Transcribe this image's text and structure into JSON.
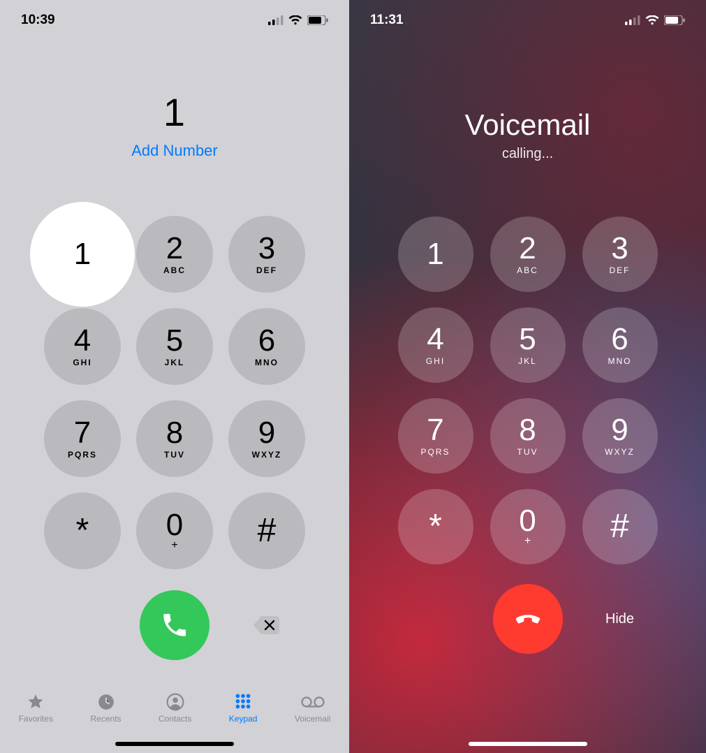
{
  "left": {
    "status_time": "10:39",
    "entered": "1",
    "add_number": "Add Number",
    "keys": [
      {
        "d": "1",
        "l": ""
      },
      {
        "d": "2",
        "l": "ABC"
      },
      {
        "d": "3",
        "l": "DEF"
      },
      {
        "d": "4",
        "l": "GHI"
      },
      {
        "d": "5",
        "l": "JKL"
      },
      {
        "d": "6",
        "l": "MNO"
      },
      {
        "d": "7",
        "l": "PQRS"
      },
      {
        "d": "8",
        "l": "TUV"
      },
      {
        "d": "9",
        "l": "WXYZ"
      },
      {
        "d": "*",
        "l": ""
      },
      {
        "d": "0",
        "l": "+"
      },
      {
        "d": "#",
        "l": ""
      }
    ],
    "tabs": {
      "favorites": "Favorites",
      "recents": "Recents",
      "contacts": "Contacts",
      "keypad": "Keypad",
      "voicemail": "Voicemail"
    }
  },
  "right": {
    "status_time": "11:31",
    "title": "Voicemail",
    "status": "calling...",
    "hide": "Hide",
    "keys": [
      {
        "d": "1",
        "l": ""
      },
      {
        "d": "2",
        "l": "ABC"
      },
      {
        "d": "3",
        "l": "DEF"
      },
      {
        "d": "4",
        "l": "GHI"
      },
      {
        "d": "5",
        "l": "JKL"
      },
      {
        "d": "6",
        "l": "MNO"
      },
      {
        "d": "7",
        "l": "PQRS"
      },
      {
        "d": "8",
        "l": "TUV"
      },
      {
        "d": "9",
        "l": "WXYZ"
      },
      {
        "d": "*",
        "l": ""
      },
      {
        "d": "0",
        "l": "+"
      },
      {
        "d": "#",
        "l": ""
      }
    ]
  }
}
